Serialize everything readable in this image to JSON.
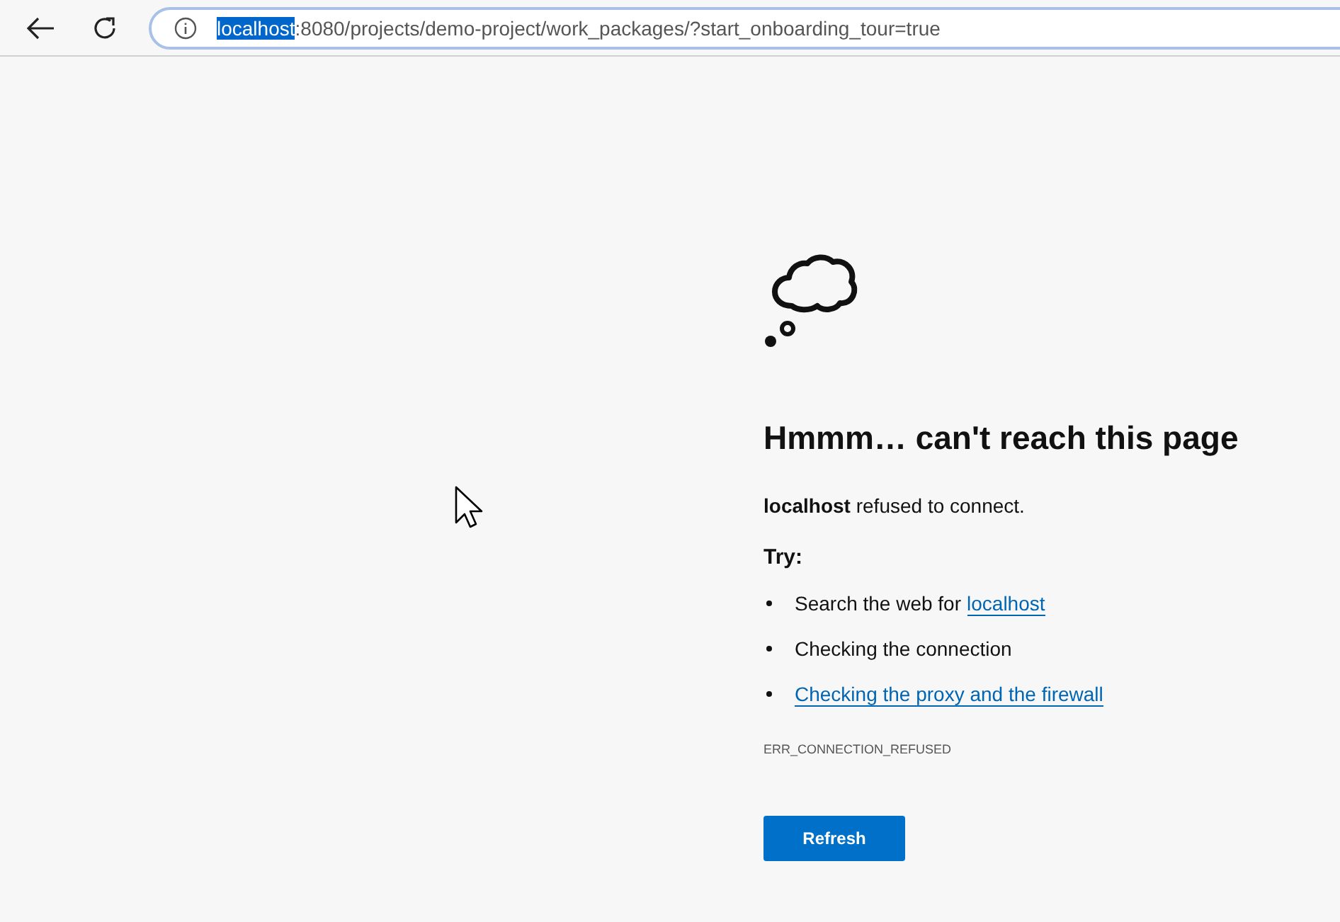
{
  "toolbar": {
    "address": {
      "selected_text": "localhost",
      "rest": ":8080/projects/demo-project/work_packages/?start_onboarding_tour=true"
    }
  },
  "error": {
    "title": "Hmmm… can't reach this page",
    "message": "**localhost** refused to connect.",
    "try_heading": "Try:",
    "suggestions": [
      {
        "text": "Search the web for",
        "link": "localhost"
      },
      {
        "text": "Checking the connection"
      },
      {
        "link": "Checking the proxy and the firewall"
      }
    ],
    "code": "ERR_CONNECTION_REFUSED",
    "button": "Refresh"
  }
}
